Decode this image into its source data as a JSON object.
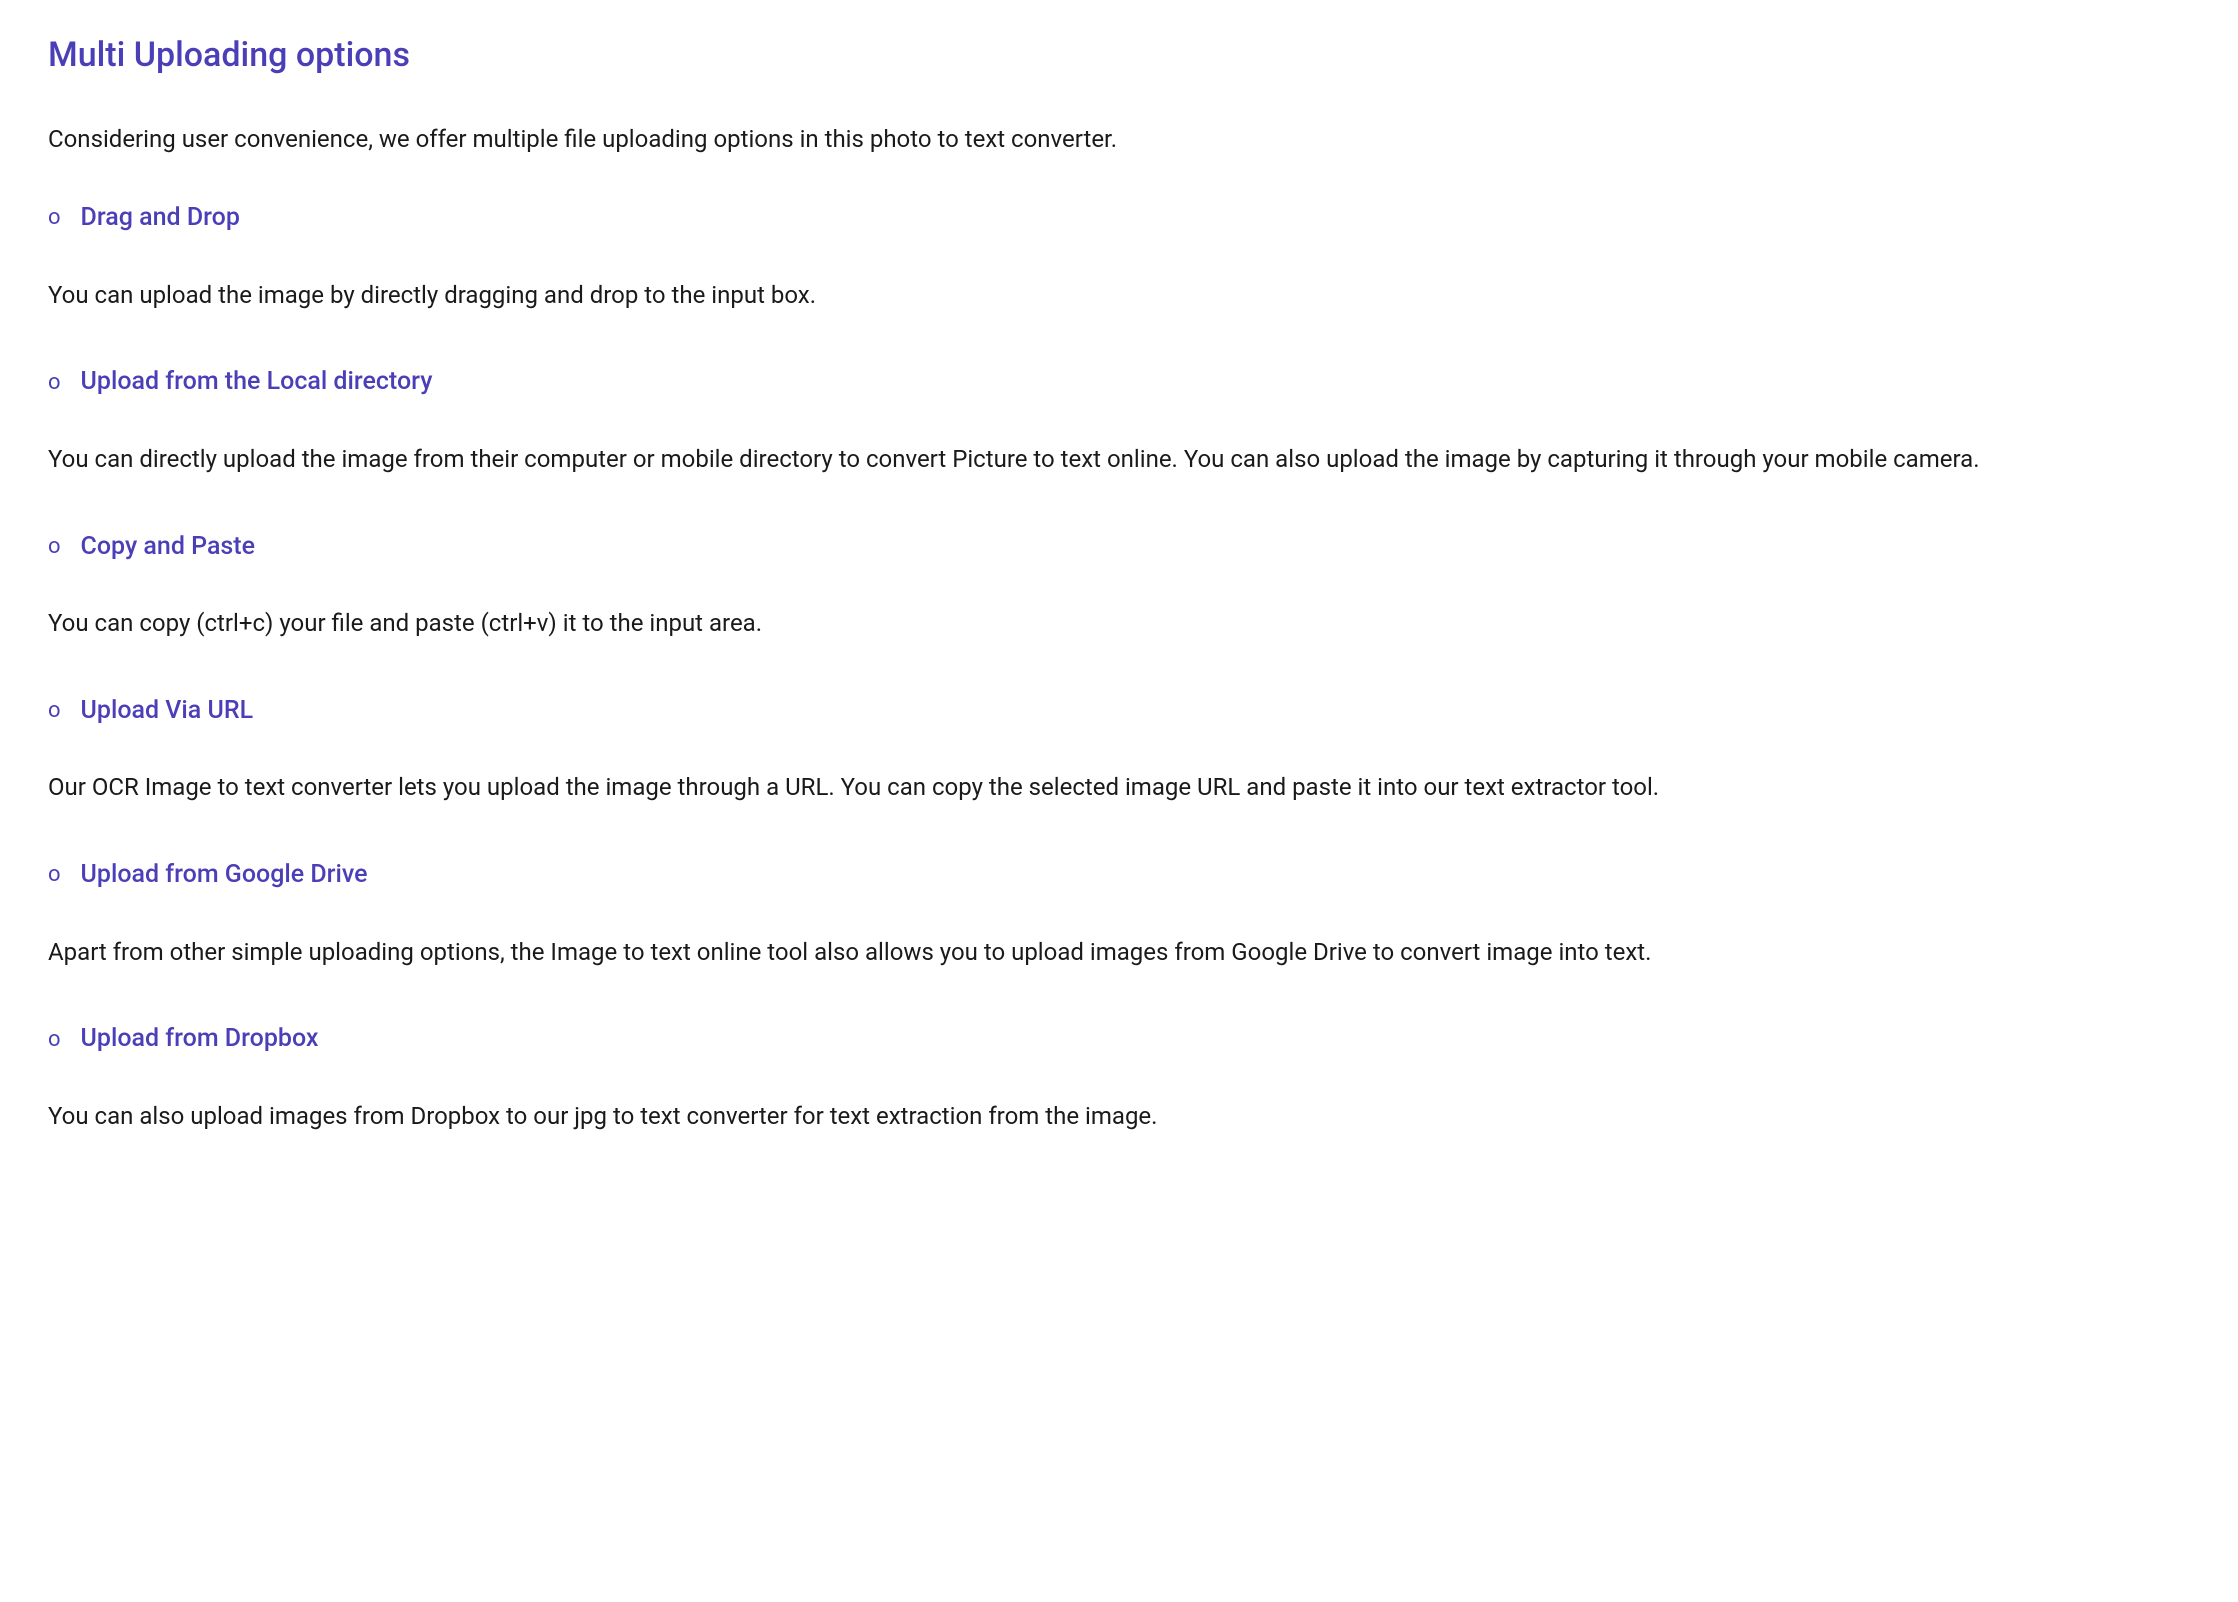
{
  "heading": "Multi Uploading options",
  "intro": "Considering user convenience, we offer multiple file uploading options in this photo to text converter.",
  "bullet": "o",
  "sections": [
    {
      "title": "Drag and Drop",
      "body": "You can upload the image by directly dragging and drop to the input box."
    },
    {
      "title": "Upload from the Local directory",
      "body": "You can directly upload the image from their computer or mobile directory to convert Picture to text online. You can also upload the image by capturing it through your mobile camera."
    },
    {
      "title": "Copy and Paste",
      "body": "You can copy (ctrl+c) your file and paste (ctrl+v) it to the input area."
    },
    {
      "title": "Upload Via URL",
      "body": "Our OCR Image to text converter lets you upload the image through a URL. You can copy the selected image URL and paste it into our text extractor tool."
    },
    {
      "title": "Upload from Google Drive",
      "body": "Apart from other simple uploading options, the Image to text online tool also allows you to upload images from Google Drive to convert image into text."
    },
    {
      "title": "Upload from Dropbox",
      "body": "You can also upload images from Dropbox to our jpg to text converter for text extraction from the image."
    }
  ]
}
